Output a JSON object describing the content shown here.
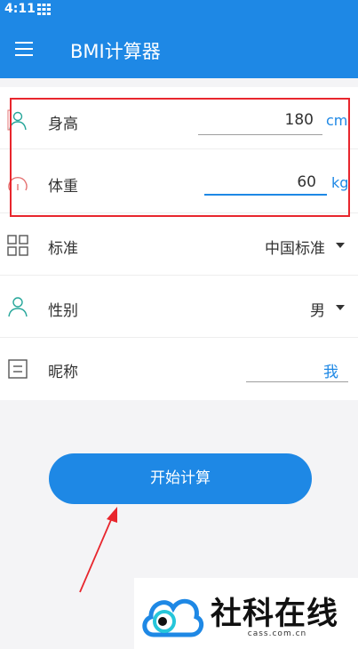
{
  "status_bar": {
    "time": "4:11"
  },
  "app_bar": {
    "title": "BMI计算器",
    "menu_icon": "hamburger-menu-icon"
  },
  "form": {
    "height": {
      "label": "身高",
      "value": "180",
      "unit": "cm",
      "icon": "person-icon"
    },
    "weight": {
      "label": "体重",
      "value": "60",
      "unit": "kg",
      "icon": "gauge-icon"
    },
    "standard": {
      "label": "标准",
      "selected": "中国标准",
      "icon": "grid-icon"
    },
    "gender": {
      "label": "性别",
      "selected": "男",
      "icon": "person-icon"
    },
    "nickname": {
      "label": "昵称",
      "value": "我",
      "icon": "document-icon"
    }
  },
  "actions": {
    "calculate_label": "开始计算"
  },
  "watermark": {
    "brand": "社科在线",
    "domain": "cass.com.cn"
  },
  "colors": {
    "primary": "#1e88e5",
    "highlight": "#e8262d",
    "teal_icon": "#26a69a",
    "pink_icon": "#e57373"
  }
}
